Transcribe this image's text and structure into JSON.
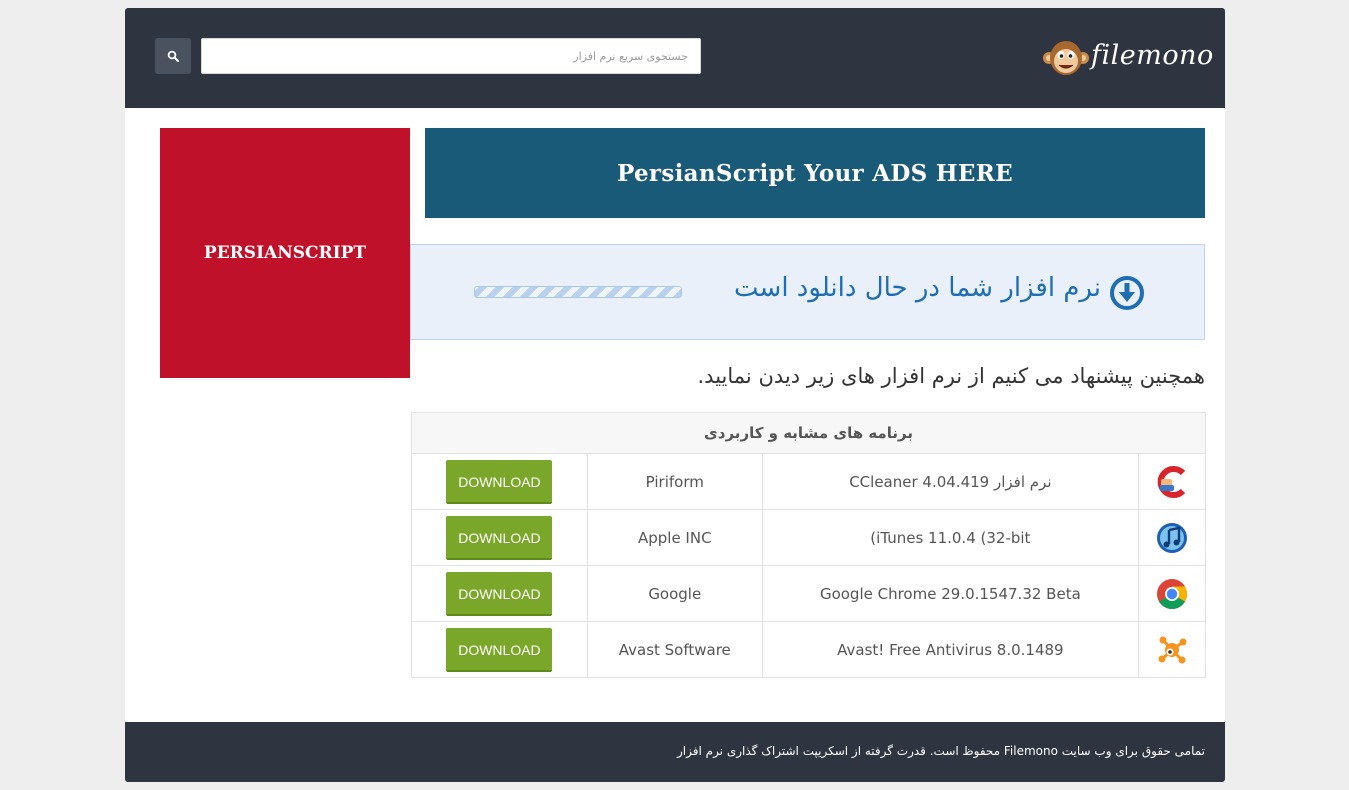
{
  "header": {
    "search": {
      "placeholder": "جستجوی سریع نرم افزار"
    },
    "search_icon": "search-icon",
    "logo": {
      "text": "filemono",
      "icon": "monkey-logo-icon"
    }
  },
  "ads": {
    "side": "PERSIANSCRIPT",
    "banner": "PersianScript Your ADS HERE"
  },
  "download": {
    "status_text": "نرم افزار شما در حال دانلود است",
    "icon": "download-circle-icon",
    "progress": 1.0
  },
  "suggestion_text": "همچنین پیشنهاد می کنیم از نرم افزار های زیر دیدن نمایید.",
  "table": {
    "header": "برنامه های مشابه و کاربردی",
    "rows": [
      {
        "icon": "ccleaner-icon",
        "name": "نرم افزار CCleaner 4.04.419",
        "publisher": "Piriform",
        "button": "DOWNLOAD"
      },
      {
        "icon": "itunes-icon",
        "name": "(iTunes 11.0.4 (32-bit",
        "publisher": "Apple INC",
        "button": "DOWNLOAD"
      },
      {
        "icon": "chrome-icon",
        "name": "Google Chrome 29.0.1547.32 Beta",
        "publisher": "Google",
        "button": "DOWNLOAD"
      },
      {
        "icon": "avast-icon",
        "name": "Avast! Free Antivirus 8.0.1489",
        "publisher": "Avast Software",
        "button": "DOWNLOAD"
      }
    ]
  },
  "footer": {
    "text": "تمامی حقوق برای وب سایت Filemono محفوظ است. قدرت گرفته از اسکریپت اشتراک گذاری نرم افزار"
  },
  "colors": {
    "header_bg": "#2e3440",
    "side_ad": "#c0112a",
    "banner_ad": "#195a78",
    "download_text": "#1f6db2",
    "download_button": "#7aa72a"
  }
}
